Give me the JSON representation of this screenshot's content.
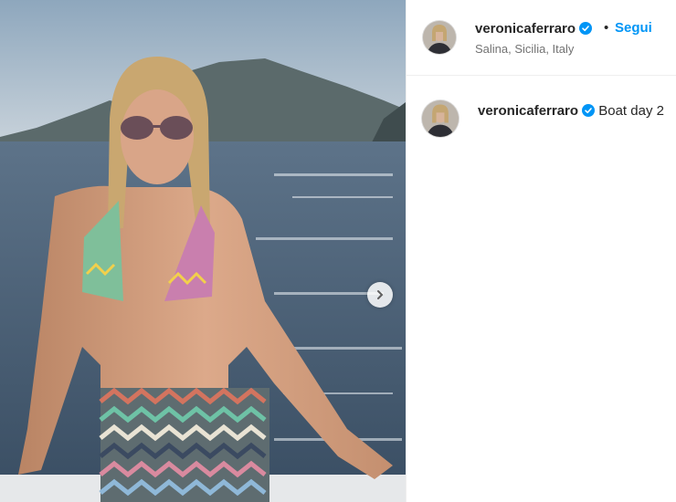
{
  "post": {
    "image_alt": "Woman in zig-zag patterned bikini on a boat with sea and island behind",
    "next_icon": "chevron-right-icon"
  },
  "header": {
    "username": "veronicaferraro",
    "verified_icon": "verified-badge-icon",
    "separator": "•",
    "follow_label": "Segui",
    "location": "Salina, Sicilia, Italy"
  },
  "caption": {
    "username": "veronicaferraro",
    "text": "Boat day 2"
  },
  "colors": {
    "accent": "#0095f6",
    "text": "#262626",
    "secondary": "#737373"
  }
}
